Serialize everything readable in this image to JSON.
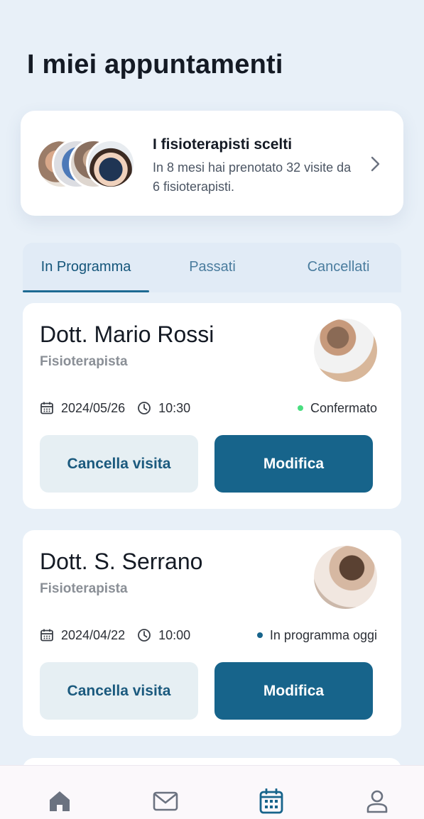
{
  "page": {
    "title": "I miei appuntamenti"
  },
  "summary": {
    "title": "I fisioterapisti scelti",
    "text": "In 8 mesi hai prenotato 32 visite da 6 fisioterapisti."
  },
  "tabs": [
    {
      "label": "In Programma",
      "active": true
    },
    {
      "label": "Passati",
      "active": false
    },
    {
      "label": "Cancellati",
      "active": false
    }
  ],
  "appointments": [
    {
      "name": "Dott. Mario Rossi",
      "role": "Fisioterapista",
      "date": "2024/05/26",
      "time": "10:30",
      "status": "Confermato",
      "status_color": "#4ade80",
      "cancel_label": "Cancella visita",
      "edit_label": "Modifica"
    },
    {
      "name": "Dott. S. Serrano",
      "role": "Fisioterapista",
      "date": "2024/04/22",
      "time": "10:00",
      "status": "In programma oggi",
      "status_color": "#17648b",
      "cancel_label": "Cancella visita",
      "edit_label": "Modifica"
    }
  ],
  "nav": [
    {
      "icon": "home-icon",
      "active": false
    },
    {
      "icon": "mail-icon",
      "active": false
    },
    {
      "icon": "calendar-icon",
      "active": true
    },
    {
      "icon": "user-icon",
      "active": false
    }
  ],
  "colors": {
    "primary": "#17648b",
    "background": "#e8f0f8",
    "nav_inactive": "#6b7280"
  }
}
